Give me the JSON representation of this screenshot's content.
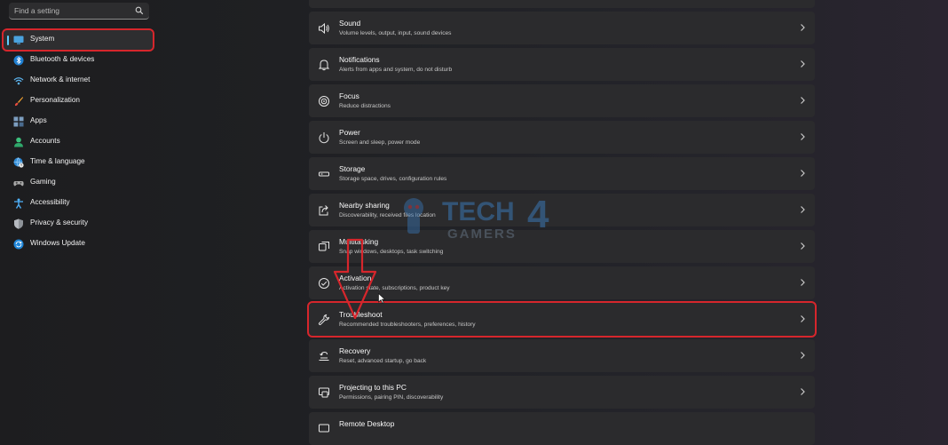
{
  "search": {
    "placeholder": "Find a setting"
  },
  "sidebar": {
    "items": [
      {
        "label": "System",
        "icon": "monitor-icon",
        "active": true
      },
      {
        "label": "Bluetooth & devices",
        "icon": "bluetooth-icon"
      },
      {
        "label": "Network & internet",
        "icon": "wifi-icon"
      },
      {
        "label": "Personalization",
        "icon": "brush-icon"
      },
      {
        "label": "Apps",
        "icon": "apps-icon"
      },
      {
        "label": "Accounts",
        "icon": "person-icon"
      },
      {
        "label": "Time & language",
        "icon": "globe-clock-icon"
      },
      {
        "label": "Gaming",
        "icon": "gamepad-icon"
      },
      {
        "label": "Accessibility",
        "icon": "accessibility-icon"
      },
      {
        "label": "Privacy & security",
        "icon": "shield-icon"
      },
      {
        "label": "Windows Update",
        "icon": "update-icon"
      }
    ]
  },
  "settings": [
    {
      "title": "Sound",
      "subtitle": "Volume levels, output, input, sound devices",
      "icon": "speaker-icon"
    },
    {
      "title": "Notifications",
      "subtitle": "Alerts from apps and system, do not disturb",
      "icon": "bell-icon"
    },
    {
      "title": "Focus",
      "subtitle": "Reduce distractions",
      "icon": "focus-icon"
    },
    {
      "title": "Power",
      "subtitle": "Screen and sleep, power mode",
      "icon": "power-icon"
    },
    {
      "title": "Storage",
      "subtitle": "Storage space, drives, configuration rules",
      "icon": "storage-icon"
    },
    {
      "title": "Nearby sharing",
      "subtitle": "Discoverability, received files location",
      "icon": "share-icon"
    },
    {
      "title": "Multitasking",
      "subtitle": "Snap windows, desktops, task switching",
      "icon": "multitask-icon"
    },
    {
      "title": "Activation",
      "subtitle": "Activation state, subscriptions, product key",
      "icon": "check-circle-icon"
    },
    {
      "title": "Troubleshoot",
      "subtitle": "Recommended troubleshooters, preferences, history",
      "icon": "wrench-icon",
      "highlight": true
    },
    {
      "title": "Recovery",
      "subtitle": "Reset, advanced startup, go back",
      "icon": "recovery-icon"
    },
    {
      "title": "Projecting to this PC",
      "subtitle": "Permissions, pairing PIN, discoverability",
      "icon": "projector-icon"
    },
    {
      "title": "Remote Desktop",
      "subtitle": "",
      "icon": "remote-desktop-icon"
    }
  ],
  "watermark": {
    "line1": "TECH",
    "digit": "4",
    "line2": "GAMERS"
  },
  "colors": {
    "accent": "#60cdff",
    "highlight": "#d6262c",
    "card": "#2b2b2d"
  }
}
